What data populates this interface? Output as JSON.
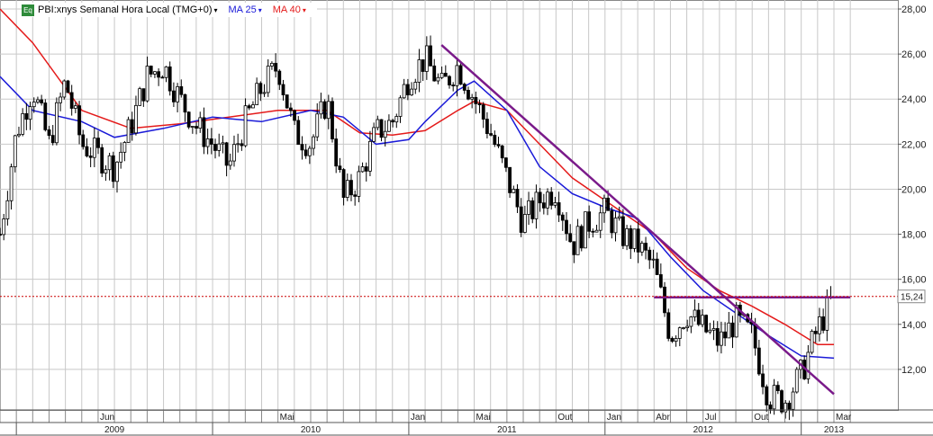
{
  "legend": {
    "badge": "Eq",
    "symbol": "PBI:xnys Semanal Hora Local (TMG+0)",
    "ma1": "MA 25",
    "ma2": "MA 40",
    "dropdown_glyph": "▾"
  },
  "colors": {
    "price": "#000000",
    "ma25": "#1a1ad8",
    "ma40": "#e41a1a",
    "trend": "#7a1a8a",
    "current": "#cc0000",
    "grid": "#c8c8c8",
    "badge": "#2e8b3a"
  },
  "chart_data": {
    "type": "candlestick",
    "ylim": [
      10.2,
      28.4
    ],
    "y_ticks": [
      "28,00",
      "26,00",
      "24,00",
      "22,00",
      "20,00",
      "18,00",
      "16,00",
      "14,00",
      "12,00"
    ],
    "y_tick_values": [
      28,
      26,
      24,
      22,
      20,
      18,
      16,
      14,
      12
    ],
    "x_range": [
      "2008-12",
      "2013-03"
    ],
    "month_ticks": [
      {
        "label": "Jun",
        "date": "2009-06"
      },
      {
        "label": "Mai",
        "date": "2010-05"
      },
      {
        "label": "Jan",
        "date": "2011-01"
      },
      {
        "label": "Mai",
        "date": "2011-05"
      },
      {
        "label": "Out",
        "date": "2011-10"
      },
      {
        "label": "Jan",
        "date": "2012-01"
      },
      {
        "label": "Abr",
        "date": "2012-04"
      },
      {
        "label": "Jul",
        "date": "2012-07"
      },
      {
        "label": "Out",
        "date": "2012-10"
      },
      {
        "label": "Mar",
        "date": "2013-03"
      }
    ],
    "year_labels": [
      {
        "label": "2009",
        "date": "2009-07"
      },
      {
        "label": "2010",
        "date": "2010-07"
      },
      {
        "label": "2011",
        "date": "2011-07"
      },
      {
        "label": "2012",
        "date": "2012-07"
      },
      {
        "label": "2013",
        "date": "2013-03"
      }
    ],
    "current_price": 15.24,
    "current_label": "15,24",
    "close_path": [
      [
        "2008-12",
        18.0
      ],
      [
        "2009-01",
        22.5
      ],
      [
        "2009-02",
        24.5
      ],
      [
        "2009-03",
        22.0
      ],
      [
        "2009-04",
        24.8
      ],
      [
        "2009-05",
        22.0
      ],
      [
        "2009-06",
        21.5
      ],
      [
        "2009-07",
        21.0
      ],
      [
        "2009-08",
        22.8
      ],
      [
        "2009-09",
        25.0
      ],
      [
        "2009-10",
        25.5
      ],
      [
        "2009-11",
        24.0
      ],
      [
        "2009-12",
        22.8
      ],
      [
        "2010-01",
        22.0
      ],
      [
        "2010-02",
        21.0
      ],
      [
        "2010-03",
        23.0
      ],
      [
        "2010-04",
        24.5
      ],
      [
        "2010-05",
        25.5
      ],
      [
        "2010-06",
        22.5
      ],
      [
        "2010-07",
        22.0
      ],
      [
        "2010-08",
        24.0
      ],
      [
        "2010-09",
        19.5
      ],
      [
        "2010-10",
        20.5
      ],
      [
        "2010-11",
        22.5
      ],
      [
        "2010-12",
        23.0
      ],
      [
        "2011-01",
        25.0
      ],
      [
        "2011-02",
        25.8
      ],
      [
        "2011-03",
        24.5
      ],
      [
        "2011-04",
        25.5
      ],
      [
        "2011-05",
        24.0
      ],
      [
        "2011-06",
        22.5
      ],
      [
        "2011-07",
        20.5
      ],
      [
        "2011-08",
        18.5
      ],
      [
        "2011-09",
        19.5
      ],
      [
        "2011-10",
        20.0
      ],
      [
        "2011-11",
        17.5
      ],
      [
        "2011-12",
        18.5
      ],
      [
        "2012-01",
        19.0
      ],
      [
        "2012-02",
        18.0
      ],
      [
        "2012-03",
        17.5
      ],
      [
        "2012-04",
        16.5
      ],
      [
        "2012-05",
        13.5
      ],
      [
        "2012-06",
        14.5
      ],
      [
        "2012-07",
        13.8
      ],
      [
        "2012-08",
        13.2
      ],
      [
        "2012-09",
        14.2
      ],
      [
        "2012-10",
        13.5
      ],
      [
        "2012-11",
        10.8
      ],
      [
        "2012-12",
        10.6
      ],
      [
        "2013-01",
        11.8
      ],
      [
        "2013-02",
        13.8
      ],
      [
        "2013-03",
        15.24
      ]
    ],
    "ma25": [
      [
        "2008-12",
        25.0
      ],
      [
        "2009-02",
        23.5
      ],
      [
        "2009-05",
        23.0
      ],
      [
        "2009-07",
        22.3
      ],
      [
        "2009-10",
        22.7
      ],
      [
        "2010-01",
        23.2
      ],
      [
        "2010-04",
        23.0
      ],
      [
        "2010-07",
        23.5
      ],
      [
        "2010-09",
        23.2
      ],
      [
        "2010-11",
        22.0
      ],
      [
        "2011-01",
        22.2
      ],
      [
        "2011-02",
        23.0
      ],
      [
        "2011-04",
        24.4
      ],
      [
        "2011-05",
        24.8
      ],
      [
        "2011-07",
        23.5
      ],
      [
        "2011-09",
        21.0
      ],
      [
        "2011-11",
        19.8
      ],
      [
        "2012-01",
        19.2
      ],
      [
        "2012-03",
        18.7
      ],
      [
        "2012-05",
        17.0
      ],
      [
        "2012-07",
        15.5
      ],
      [
        "2012-09",
        14.5
      ],
      [
        "2012-11",
        13.5
      ],
      [
        "2013-01",
        12.6
      ],
      [
        "2013-03",
        12.5
      ]
    ],
    "ma40": [
      [
        "2008-12",
        28.0
      ],
      [
        "2009-02",
        26.5
      ],
      [
        "2009-05",
        23.5
      ],
      [
        "2009-08",
        22.7
      ],
      [
        "2009-11",
        22.9
      ],
      [
        "2010-02",
        23.2
      ],
      [
        "2010-05",
        23.5
      ],
      [
        "2010-08",
        23.5
      ],
      [
        "2010-10",
        22.5
      ],
      [
        "2010-12",
        22.4
      ],
      [
        "2011-02",
        22.6
      ],
      [
        "2011-04",
        23.5
      ],
      [
        "2011-05",
        23.9
      ],
      [
        "2011-07",
        23.5
      ],
      [
        "2011-09",
        22.0
      ],
      [
        "2011-11",
        20.5
      ],
      [
        "2012-02",
        19.0
      ],
      [
        "2012-04",
        18.0
      ],
      [
        "2012-06",
        16.5
      ],
      [
        "2012-08",
        15.5
      ],
      [
        "2012-10",
        14.8
      ],
      [
        "2012-12",
        14.0
      ],
      [
        "2013-02",
        13.1
      ],
      [
        "2013-03",
        13.1
      ]
    ],
    "trendlines": [
      {
        "from": [
          "2011-03",
          26.4
        ],
        "to": [
          "2013-03",
          10.9
        ]
      },
      {
        "from": [
          "2012-04",
          15.2
        ],
        "to": [
          "2013-04",
          15.2
        ]
      }
    ]
  }
}
